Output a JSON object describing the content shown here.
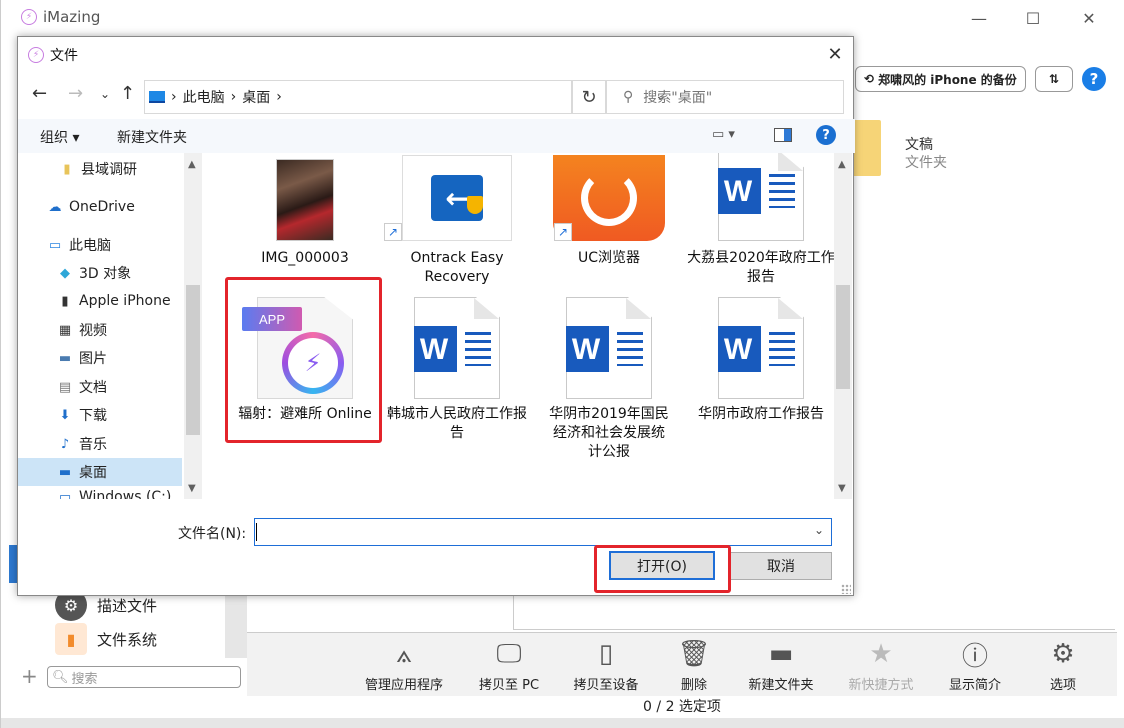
{
  "app": {
    "title": "iMazing",
    "backup_label": "郑啸风的 iPhone 的备份",
    "help_label": "?",
    "folder": {
      "name": "文稿",
      "type": "文件夹"
    },
    "sidebar": [
      {
        "label": "描述文件",
        "icon": "gear-badge-icon"
      },
      {
        "label": "文件系统",
        "icon": "file-system-icon"
      }
    ],
    "search_placeholder": "搜索",
    "toolbar": [
      {
        "label": "管理应用程序",
        "icon": "app-store-icon",
        "enabled": true
      },
      {
        "label": "拷贝至 PC",
        "icon": "copy-to-pc-icon",
        "enabled": true
      },
      {
        "label": "拷贝至设备",
        "icon": "copy-to-device-icon",
        "enabled": true
      },
      {
        "label": "删除",
        "icon": "trash-icon",
        "enabled": true
      },
      {
        "label": "新建文件夹",
        "icon": "new-folder-icon",
        "enabled": true
      },
      {
        "label": "新快捷方式",
        "icon": "star-icon",
        "enabled": false
      },
      {
        "label": "显示简介",
        "icon": "info-icon",
        "enabled": true
      },
      {
        "label": "选项",
        "icon": "gear-icon",
        "enabled": true
      }
    ],
    "status": "0 / 2 选定项"
  },
  "dialog": {
    "title": "文件",
    "breadcrumb": [
      "此电脑",
      "桌面"
    ],
    "search_placeholder": "搜索\"桌面\"",
    "commands": {
      "organize": "组织 ▾",
      "new_folder": "新建文件夹",
      "help": "?"
    },
    "tree": [
      {
        "label": "县域调研",
        "icon": "folder-icon"
      },
      {
        "label": "OneDrive",
        "icon": "cloud-icon"
      },
      {
        "label": "此电脑",
        "icon": "computer-icon"
      },
      {
        "label": "3D 对象",
        "icon": "cube-icon"
      },
      {
        "label": "Apple iPhone",
        "icon": "phone-icon"
      },
      {
        "label": "视频",
        "icon": "video-icon"
      },
      {
        "label": "图片",
        "icon": "picture-icon"
      },
      {
        "label": "文档",
        "icon": "document-icon"
      },
      {
        "label": "下载",
        "icon": "download-icon"
      },
      {
        "label": "音乐",
        "icon": "music-icon"
      },
      {
        "label": "桌面",
        "icon": "desktop-icon",
        "selected": true
      },
      {
        "label": "Windows (C:)",
        "icon": "drive-icon"
      }
    ],
    "files": [
      {
        "label": "IMG_000003",
        "type": "photo"
      },
      {
        "label": "Ontrack Easy Recovery",
        "type": "shortcut"
      },
      {
        "label": "UC浏览器",
        "type": "shortcut"
      },
      {
        "label": "大荔县2020年政府工作报告",
        "type": "word"
      },
      {
        "label": "辐射：避难所 Online",
        "type": "app",
        "badge": "APP"
      },
      {
        "label": "韩城市人民政府工作报告",
        "type": "word"
      },
      {
        "label": "华阴市2019年国民经济和社会发展统计公报",
        "type": "word"
      },
      {
        "label": "华阴市政府工作报告",
        "type": "word"
      }
    ],
    "filename_label": "文件名(N):",
    "filename_value": "",
    "open_label": "打开(O)",
    "cancel_label": "取消"
  },
  "colors": {
    "accent": "#1e6ed7",
    "annotation": "#e3242b",
    "word_blue": "#185abd",
    "selection": "#cce4f7"
  }
}
